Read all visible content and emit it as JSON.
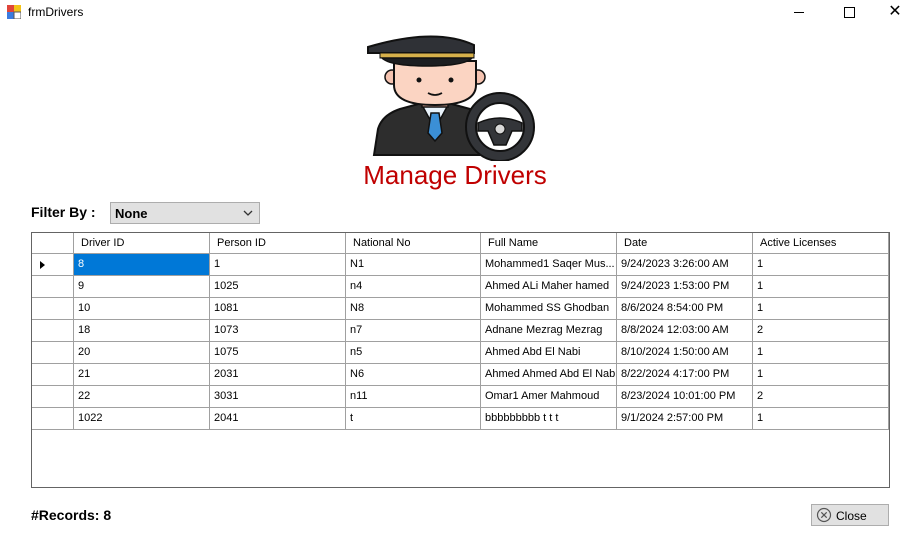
{
  "window": {
    "title": "frmDrivers"
  },
  "header": {
    "title": "Manage Drivers",
    "title_color": "#c00000",
    "logo_icon": "driver-with-steering-wheel-icon"
  },
  "filter": {
    "label": "Filter By :",
    "selected": "None"
  },
  "grid": {
    "columns": [
      "Driver ID",
      "Person ID",
      "National No",
      "Full Name",
      "Date",
      "Active Licenses"
    ],
    "rows": [
      {
        "driver_id": "8",
        "person_id": "1",
        "national_no": "N1",
        "full_name": "Mohammed1 Saqer Mus...",
        "date": "9/24/2023 3:26:00 AM",
        "active_licenses": "1"
      },
      {
        "driver_id": "9",
        "person_id": "1025",
        "national_no": "n4",
        "full_name": "Ahmed ALi Maher hamed",
        "date": "9/24/2023 1:53:00 PM",
        "active_licenses": "1"
      },
      {
        "driver_id": "10",
        "person_id": "1081",
        "national_no": "N8",
        "full_name": "Mohammed SS  Ghodban",
        "date": "8/6/2024 8:54:00 PM",
        "active_licenses": "1"
      },
      {
        "driver_id": "18",
        "person_id": "1073",
        "national_no": "n7",
        "full_name": "Adnane Mezrag  Mezrag",
        "date": "8/8/2024 12:03:00 AM",
        "active_licenses": "2"
      },
      {
        "driver_id": "20",
        "person_id": "1075",
        "national_no": "n5",
        "full_name": "Ahmed Abd  El Nabi",
        "date": "8/10/2024 1:50:00 AM",
        "active_licenses": "1"
      },
      {
        "driver_id": "21",
        "person_id": "2031",
        "national_no": "N6",
        "full_name": "Ahmed Ahmed Abd El Nabi",
        "date": "8/22/2024 4:17:00 PM",
        "active_licenses": "1"
      },
      {
        "driver_id": "22",
        "person_id": "3031",
        "national_no": "n11",
        "full_name": "Omar1 Amer  Mahmoud",
        "date": "8/23/2024 10:01:00 PM",
        "active_licenses": "2"
      },
      {
        "driver_id": "1022",
        "person_id": "2041",
        "national_no": "t",
        "full_name": "bbbbbbbbb t t t",
        "date": "9/1/2024 2:57:00 PM",
        "active_licenses": "1"
      }
    ],
    "selection_color": "#0078d7"
  },
  "footer": {
    "records_label": "#Records:",
    "records_count": "8",
    "close_label": "Close"
  }
}
